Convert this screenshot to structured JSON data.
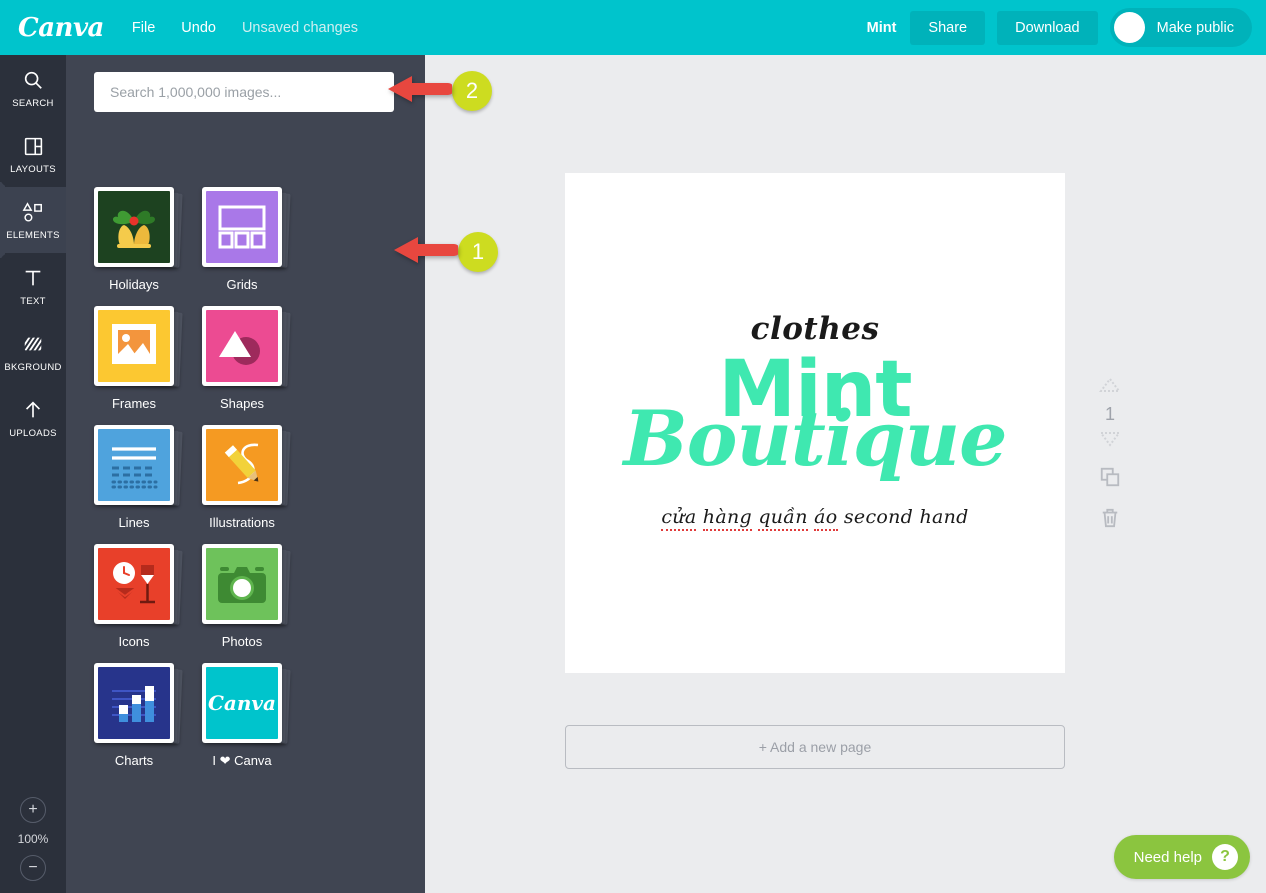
{
  "header": {
    "logo": "Canva",
    "menus": [
      {
        "label": "File",
        "dim": false
      },
      {
        "label": "Undo",
        "dim": false
      },
      {
        "label": "Unsaved changes",
        "dim": true
      }
    ],
    "design_name": "Mint",
    "share_label": "Share",
    "download_label": "Download",
    "make_public_label": "Make public",
    "accent_color": "#00c4cc",
    "button_color": "#00b2ba"
  },
  "rail": {
    "items": [
      {
        "label": "SEARCH",
        "icon": "search-icon",
        "active": false
      },
      {
        "label": "LAYOUTS",
        "icon": "layouts-icon",
        "active": false
      },
      {
        "label": "ELEMENTS",
        "icon": "elements-icon",
        "active": true
      },
      {
        "label": "TEXT",
        "icon": "text-icon",
        "active": false
      },
      {
        "label": "BKGROUND",
        "icon": "background-icon",
        "active": false
      },
      {
        "label": "UPLOADS",
        "icon": "uploads-icon",
        "active": false
      }
    ],
    "zoom_in": "+",
    "zoom_level": "100%",
    "zoom_out": "−"
  },
  "panel": {
    "search_placeholder": "Search 1,000,000 images...",
    "search_value": "",
    "tiles": [
      {
        "label": "Holidays",
        "icon": "holly-bells-icon",
        "bg": "#1d4220"
      },
      {
        "label": "Grids",
        "icon": "grid-layout-icon",
        "bg": "#a978e8"
      },
      {
        "label": "Frames",
        "icon": "picture-frame-icon",
        "bg": "#fcc831"
      },
      {
        "label": "Shapes",
        "icon": "shapes-icon",
        "bg": "#ec4b92"
      },
      {
        "label": "Lines",
        "icon": "lines-icon",
        "bg": "#4fa3dd"
      },
      {
        "label": "Illustrations",
        "icon": "pencil-icon",
        "bg": "#f59a22"
      },
      {
        "label": "Icons",
        "icon": "clock-mail-icon",
        "bg": "#e8402a"
      },
      {
        "label": "Photos",
        "icon": "camera-icon",
        "bg": "#6ec25b"
      },
      {
        "label": "Charts",
        "icon": "bar-chart-icon",
        "bg": "#27348b"
      },
      {
        "label": "I ❤ Canva",
        "icon": "canva-logo-icon",
        "bg": "#00c4cc"
      }
    ]
  },
  "editor": {
    "design": {
      "clothes": "clothes",
      "mint": "Mint",
      "boutique": "Boutique",
      "subtitle_parts": [
        {
          "text": "cửa",
          "squiggle": true
        },
        {
          "text": " ",
          "squiggle": false
        },
        {
          "text": "hàng",
          "squiggle": true
        },
        {
          "text": " ",
          "squiggle": false
        },
        {
          "text": "quần",
          "squiggle": true
        },
        {
          "text": " ",
          "squiggle": false
        },
        {
          "text": "áo",
          "squiggle": true
        },
        {
          "text": " second hand",
          "squiggle": false
        }
      ],
      "mint_color": "#3fe8b0"
    },
    "page_number": "1",
    "add_page_label": "+ Add a new page",
    "page_controls": [
      {
        "name": "move-page-up-icon"
      },
      {
        "name": "move-page-down-icon"
      },
      {
        "name": "duplicate-page-icon"
      },
      {
        "name": "delete-page-icon"
      }
    ]
  },
  "help": {
    "label": "Need help",
    "badge": "?",
    "color": "#8bc53f"
  },
  "annotations": [
    {
      "number": "1",
      "target": "frames-tile",
      "color": "#cddc20",
      "arrow_color": "#e8473f"
    },
    {
      "number": "2",
      "target": "search-input",
      "color": "#cddc20",
      "arrow_color": "#e8473f"
    }
  ]
}
